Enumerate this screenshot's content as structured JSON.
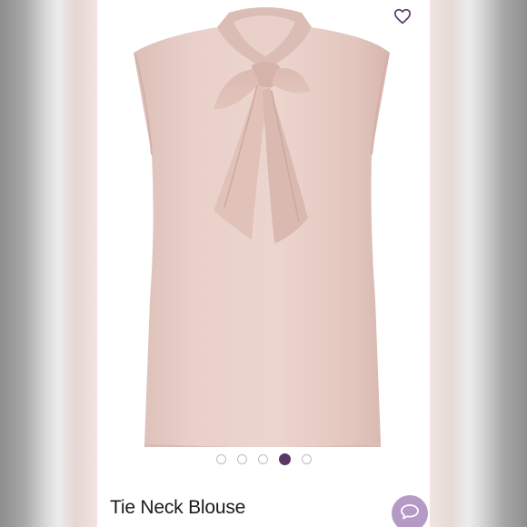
{
  "listing": {
    "title": "Tie Neck Blouse",
    "image_count": 5,
    "active_image_index": 3
  },
  "icons": {
    "like": "heart-outline-icon",
    "comment": "speech-bubble-icon"
  },
  "colors": {
    "blouse": "#e7cdc6",
    "active_dot": "#5a3766",
    "chat_button": "#b49ac4",
    "heart_stroke": "#5a3766"
  }
}
